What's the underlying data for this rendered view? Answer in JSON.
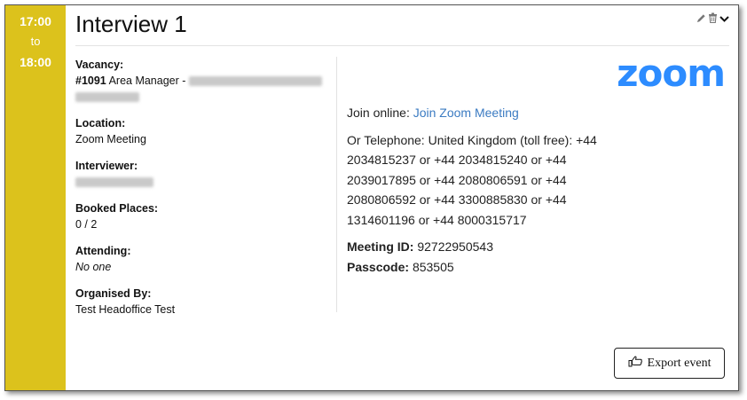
{
  "time": {
    "start": "17:00",
    "separator": "to",
    "end": "18:00"
  },
  "event": {
    "title": "Interview 1"
  },
  "toolbar": {
    "edit_icon": "pencil-icon",
    "delete_icon": "trash-icon",
    "expand_icon": "chevron-down-icon"
  },
  "details": {
    "vacancy_label": "Vacancy:",
    "vacancy_ref": "#1091",
    "vacancy_text": "Area Manager -",
    "location_label": "Location:",
    "location_value": "Zoom Meeting",
    "interviewer_label": "Interviewer:",
    "booked_label": "Booked Places:",
    "booked_value": "0 / 2",
    "attending_label": "Attending:",
    "attending_value": "No one",
    "organised_label": "Organised By:",
    "organised_value": "Test Headoffice Test"
  },
  "zoom": {
    "logo_text": "zoom",
    "join_prefix": "Join online:",
    "join_link": "Join Zoom Meeting",
    "telephone": "Or Telephone: United Kingdom (toll free): +44 2034815237 or +44 2034815240 or +44 2039017895 or +44 2080806591 or +44 2080806592 or +44 3300885830 or +44 1314601196 or +44 8000315717",
    "meeting_id_label": "Meeting ID:",
    "meeting_id": "92722950543",
    "passcode_label": "Passcode:",
    "passcode": "853505"
  },
  "export": {
    "label": "Export event",
    "icon": "hand-pointing-icon"
  },
  "colors": {
    "timebar": "#dcc21c",
    "link": "#3b7bc2",
    "zoom_brand": "#2d8cff"
  }
}
